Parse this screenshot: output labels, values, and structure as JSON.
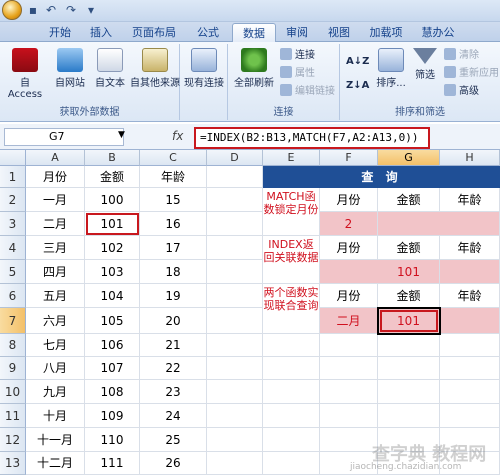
{
  "ribbon": {
    "tabs": [
      {
        "label": "开始"
      },
      {
        "label": "插入"
      },
      {
        "label": "页面布局"
      },
      {
        "label": "公式"
      },
      {
        "label": "数据"
      },
      {
        "label": "审阅"
      },
      {
        "label": "视图"
      },
      {
        "label": "加载项"
      },
      {
        "label": "慧办公"
      }
    ],
    "active_tab": "数据",
    "groups": {
      "external": {
        "label": "获取外部数据",
        "buttons": [
          "自 Access",
          "自网站",
          "自文本",
          "自其他来源"
        ]
      },
      "existing": "现有连接",
      "connections": {
        "label": "连接",
        "refresh": "全部刷新",
        "small": [
          "连接",
          "属性",
          "编辑链接"
        ]
      },
      "sort": {
        "label": "排序和筛选",
        "sort_btn": "排序...",
        "filter_btn": "筛选",
        "small": [
          "清除",
          "重新应用",
          "高级"
        ]
      }
    }
  },
  "formula_bar": {
    "name_box": "G7",
    "fx": "fx",
    "formula": "=INDEX(B2:B13,MATCH(F7,A2:A13,0))"
  },
  "grid": {
    "columns": [
      "A",
      "B",
      "C",
      "D",
      "E",
      "F",
      "G",
      "H"
    ],
    "rows": [
      "1",
      "2",
      "3",
      "4",
      "5",
      "6",
      "7",
      "8",
      "9",
      "10",
      "11",
      "12",
      "13"
    ],
    "header_row": {
      "A": "月份",
      "B": "金额",
      "C": "年龄"
    },
    "data": [
      {
        "A": "一月",
        "B": "100",
        "C": "15"
      },
      {
        "A": "二月",
        "B": "101",
        "C": "16"
      },
      {
        "A": "三月",
        "B": "102",
        "C": "17"
      },
      {
        "A": "四月",
        "B": "103",
        "C": "18"
      },
      {
        "A": "五月",
        "B": "104",
        "C": "19"
      },
      {
        "A": "六月",
        "B": "105",
        "C": "20"
      },
      {
        "A": "七月",
        "B": "106",
        "C": "21"
      },
      {
        "A": "八月",
        "B": "107",
        "C": "22"
      },
      {
        "A": "九月",
        "B": "108",
        "C": "23"
      },
      {
        "A": "十月",
        "B": "109",
        "C": "24"
      },
      {
        "A": "十一月",
        "B": "110",
        "C": "25"
      },
      {
        "A": "十二月",
        "B": "111",
        "C": "26"
      }
    ],
    "query_title": "查 询",
    "sections": [
      {
        "label": "MATCH函数锁定月份",
        "headers": [
          "月份",
          "金额",
          "年龄"
        ],
        "result": "2"
      },
      {
        "label": "INDEX返回关联数据",
        "headers": [
          "月份",
          "金额",
          "年龄"
        ],
        "result": "101"
      },
      {
        "label": "两个函数实现联合查询",
        "headers": [
          "月份",
          "金额",
          "年龄"
        ],
        "month": "二月",
        "result": "101"
      }
    ]
  },
  "watermark": {
    "line1": "查字典 教程网",
    "line2": "jiaocheng.chazidian.com"
  },
  "colors": {
    "accent": "#1f4f96",
    "highlight": "#f2c4c8",
    "alert": "#c8181e"
  }
}
